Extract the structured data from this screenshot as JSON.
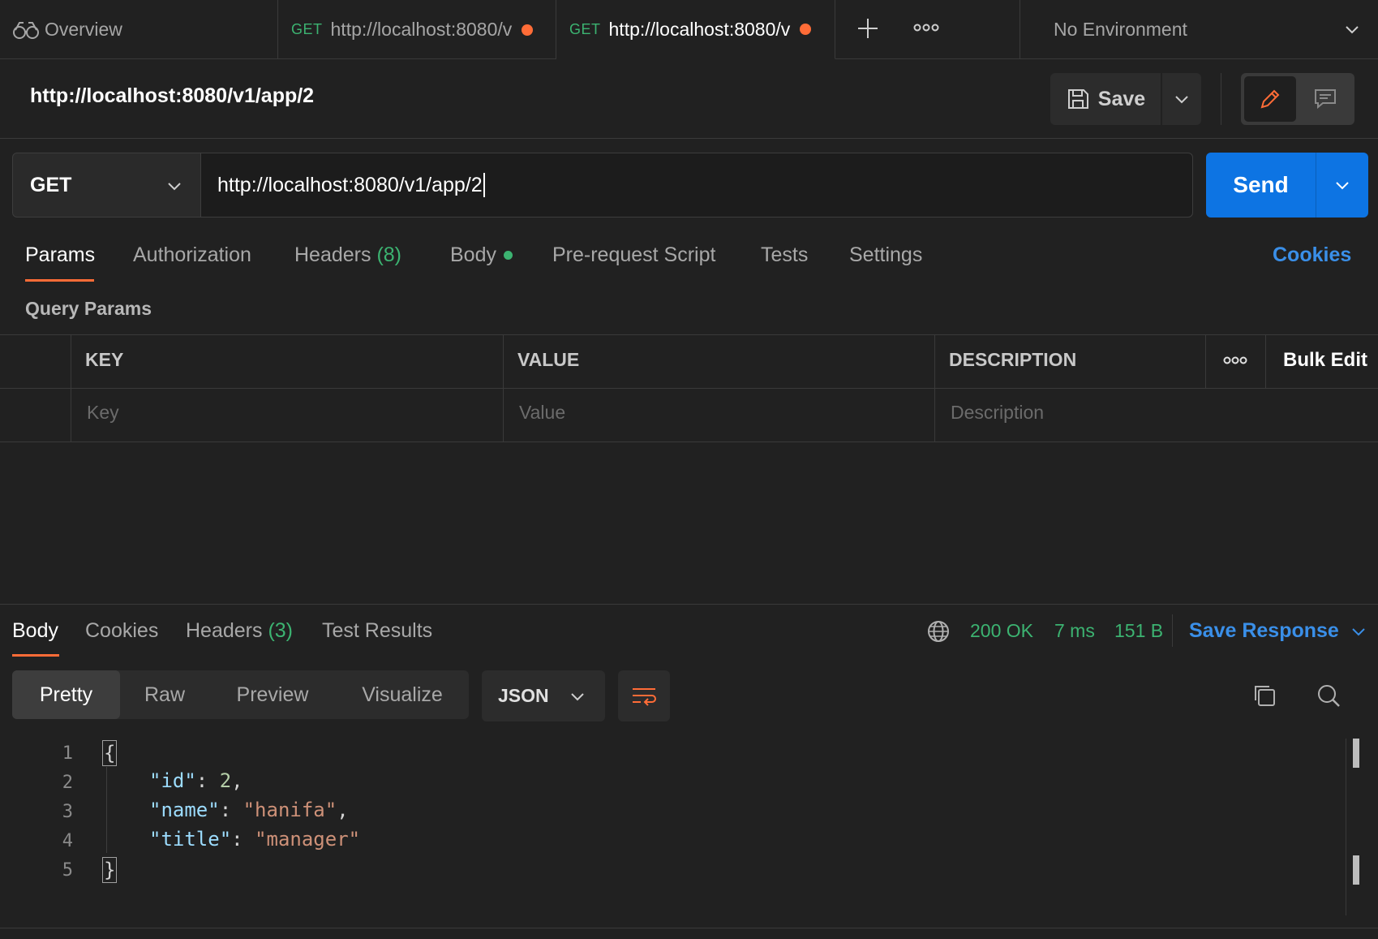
{
  "tabs": {
    "overview": "Overview",
    "tab1": {
      "method": "GET",
      "label": "http://localhost:8080/v"
    },
    "tab2": {
      "method": "GET",
      "label": "http://localhost:8080/v"
    },
    "environment": "No Environment"
  },
  "request": {
    "title": "http://localhost:8080/v1/app/2",
    "save_label": "Save",
    "method": "GET",
    "url": "http://localhost:8080/v1/app/2",
    "send_label": "Send"
  },
  "request_tabs": [
    {
      "label": "Params"
    },
    {
      "label": "Authorization"
    },
    {
      "label": "Headers",
      "count": "(8)"
    },
    {
      "label": "Body"
    },
    {
      "label": "Pre-request Script"
    },
    {
      "label": "Tests"
    },
    {
      "label": "Settings"
    }
  ],
  "cookies_link": "Cookies",
  "params": {
    "section_title": "Query Params",
    "columns": {
      "key": "KEY",
      "value": "VALUE",
      "description": "DESCRIPTION"
    },
    "bulk_edit": "Bulk Edit",
    "placeholders": {
      "key": "Key",
      "value": "Value",
      "description": "Description"
    }
  },
  "response": {
    "tabs": [
      {
        "label": "Body"
      },
      {
        "label": "Cookies"
      },
      {
        "label": "Headers",
        "count": "(3)"
      },
      {
        "label": "Test Results"
      }
    ],
    "status": "200 OK",
    "time": "7 ms",
    "size": "151 B",
    "save_response": "Save Response",
    "views": [
      "Pretty",
      "Raw",
      "Preview",
      "Visualize"
    ],
    "format": "JSON",
    "line_numbers": [
      "1",
      "2",
      "3",
      "4",
      "5"
    ],
    "json": {
      "open": "{",
      "id_key": "\"id\"",
      "id_val": "2",
      "name_key": "\"name\"",
      "name_val": "\"hanifa\"",
      "title_key": "\"title\"",
      "title_val": "\"manager\"",
      "close": "}"
    }
  },
  "colors": {
    "accent": "#ff6c37",
    "send": "#0d74e3",
    "success": "#3cb371",
    "link": "#3a8fe8"
  }
}
